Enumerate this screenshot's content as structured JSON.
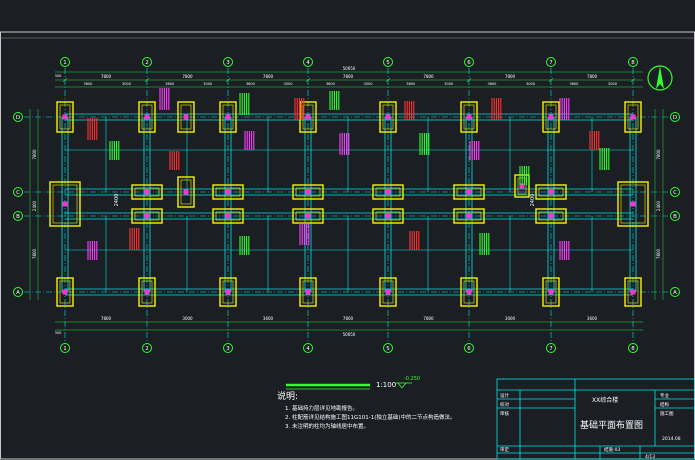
{
  "drawing": {
    "axes_x": [
      "1",
      "2",
      "3",
      "4",
      "5",
      "6",
      "7",
      "8"
    ],
    "axes_y": [
      "D",
      "C",
      "B",
      "A"
    ],
    "total_dim": "50650",
    "top_bays": [
      "7800",
      "7800",
      "7800",
      "7800",
      "7800",
      "7800",
      "7800"
    ],
    "top_sub": [
      "3600",
      "3000",
      "3600",
      "3000",
      "3600",
      "3000",
      "3600",
      "3000",
      "3600",
      "3000",
      "3600",
      "3000",
      "3600",
      "3000"
    ],
    "bottom_bays": [
      "7800",
      "3000",
      "3600",
      "7800",
      "7800",
      "3000",
      "3600",
      "7800"
    ],
    "side_dims_left": [
      "7800",
      "2400",
      "7800"
    ],
    "side_dims_right": [
      "7800",
      "2400",
      "7800"
    ],
    "end_dims": [
      "300",
      "300"
    ],
    "center_labels": [
      "2400",
      "2400"
    ],
    "scale_text": "1:100",
    "elev_text": "-0.250",
    "notes_title": "说明:",
    "notes": [
      "1. 基础持力层详见地勘报告。",
      "2. 柱配筋详见结构施工图11G101-1(独立基础)中的二节点构造做法。",
      "3. 未注明的柱均为轴线居中布置。"
    ]
  },
  "title_block": {
    "project": "XX综合楼",
    "drawing_title": "基础平面布置图",
    "stage": "施工图",
    "sheet": "结施-03",
    "rows_left": [
      "设计",
      "校对",
      "审核",
      "审定"
    ],
    "rows_right_top": [
      "专业",
      "结构"
    ],
    "date": "2014.08",
    "page": "4/13"
  },
  "colors": {
    "bg": "#1b1e23",
    "grid": "#00e5e5",
    "footing": "#f5f500",
    "column": "#ff2fd0",
    "text": "#ffffff",
    "dim": "#20e040",
    "anno_red": "#ff3030",
    "anno_green": "#30ff30",
    "anno_magenta": "#ff3dff"
  }
}
